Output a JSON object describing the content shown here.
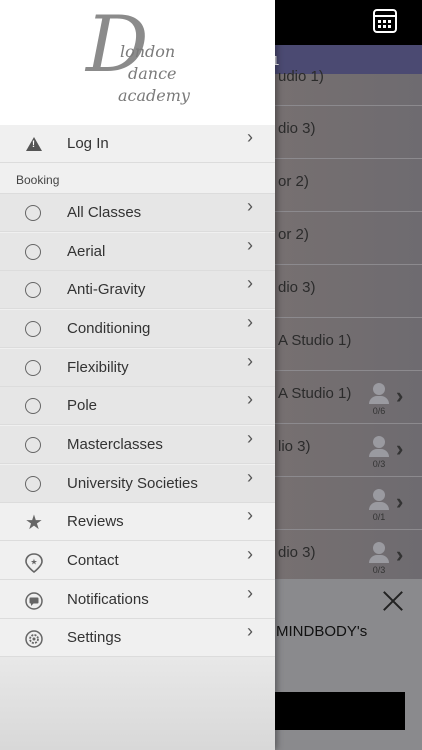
{
  "app": {
    "logo_letter": "D",
    "logo_line1": "london",
    "logo_line2": "dance",
    "logo_line3": "academy"
  },
  "background": {
    "subbar_text": "1",
    "rows": [
      {
        "text": "udio 1)",
        "count": ""
      },
      {
        "text": "dio 3)",
        "count": ""
      },
      {
        "text": "or 2)",
        "count": ""
      },
      {
        "text": "or 2)",
        "count": ""
      },
      {
        "text": "dio 3)",
        "count": ""
      },
      {
        "text": "A Studio 1)",
        "count": ""
      },
      {
        "text": "A Studio 1)",
        "count": "0/6"
      },
      {
        "text": "lio 3)",
        "count": "0/3"
      },
      {
        "text": "",
        "count": "0/1"
      },
      {
        "text": "dio 3)",
        "count": "0/3"
      }
    ],
    "popup_text": "MINDBODY's"
  },
  "drawer": {
    "login_label": "Log In",
    "section_booking": "Booking",
    "booking_items": [
      "All Classes",
      "Aerial",
      "Anti-Gravity",
      "Conditioning",
      "Flexibility",
      "Pole",
      "Masterclasses",
      "University Societies"
    ],
    "bottom_items": [
      {
        "label": "Reviews",
        "icon": "star-icon"
      },
      {
        "label": "Contact",
        "icon": "location-pin-icon"
      },
      {
        "label": "Notifications",
        "icon": "chat-bubble-icon"
      },
      {
        "label": "Settings",
        "icon": "gear-icon"
      }
    ],
    "chevron": "›"
  }
}
